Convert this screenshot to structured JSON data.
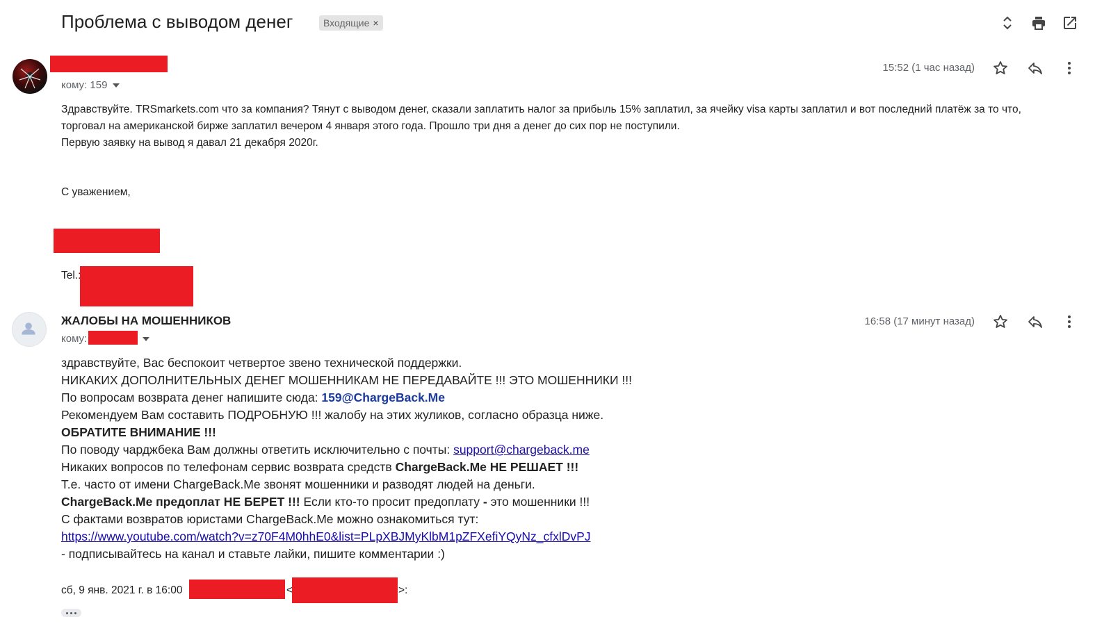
{
  "header": {
    "subject": "Проблема с выводом денег",
    "label": "Входящие",
    "label_close": "×"
  },
  "icons": {
    "expand": "unfold-icon",
    "print": "print-icon",
    "open_new": "open-in-new-window-icon",
    "star": "star-icon",
    "reply": "reply-icon",
    "more": "more-vertical-icon"
  },
  "message1": {
    "time": "15:52 (1 час назад)",
    "to_label": "кому: 159",
    "lines": [
      "Здравствуйте. TRSmarkets.com что за компания? Тянут с выводом денег, сказали заплатить налог за прибыль 15% заплатил, за ячейку visa карты заплатил и вот последний платёж за то что,",
      "торговал на американской бирже заплатил вечером 4 января этого года. Прошло три дня а денег до сих пор не поступили.",
      "Первую заявку на вывод я давал 21 декабря 2020г."
    ],
    "regards": "С уважением,",
    "tel_label": "Tel.:"
  },
  "message2": {
    "sender": "ЖАЛОБЫ НА МОШЕННИКОВ",
    "time": "16:58 (17 минут назад)",
    "to_label": "кому:",
    "l1": "здравствуйте, Вас беспокоит четвертое звено технической поддержки.",
    "l2": "НИКАКИХ ДОПОЛНИТЕЛЬНЫХ ДЕНЕГ МОШЕННИКАМ НЕ ПЕРЕДАВАЙТЕ !!! ЭТО МОШЕННИКИ !!!",
    "l3_text": "По вопросам возврата денег напишите сюда: ",
    "l3_email": "159@ChargeBack.Me",
    "l4": "Рекомендуем Вам составить ПОДРОБНУЮ !!! жалобу на этих жуликов, согласно образца ниже.",
    "l5": "ОБРАТИТЕ ВНИМАНИЕ !!!",
    "l6_text": "По поводу чарджбека Вам должны ответить исключительно с почты: ",
    "l6_email": "support@chargeback.me",
    "l7_text": "Никаких вопросов по телефонам сервис возврата средств ",
    "l7_bold": "ChargeBack.Me НЕ РЕШАЕТ !!!",
    "l8": "Т.е. часто от имени ChargeBack.Me звонят мошенники и разводят людей на деньги.",
    "l9_bold": "ChargeBack.Me предоплат НЕ БЕРЕТ !!!",
    "l9_text": " Если кто-то просит предоплату",
    "l9_dash": " - ",
    "l9_tail": "это мошенники !!!",
    "l10": "С фактами возвратов юристами ChargeBack.Me можно ознакомиться тут:",
    "l11_link": "https://www.youtube.com/watch?v=z70F4M0hhE0&list=PLpXBJMyKlbM1pZFXefiYQyNz_cfxlDvPJ",
    "l12": " - подписывайтесь на канал и ставьте лайки, пишите комментарии :)",
    "quote_date": "сб, 9 янв. 2021 г. в 16:00",
    "quote_lt": "<",
    "quote_gt": ">:"
  },
  "colors": {
    "redaction": "#ec1c24",
    "link": "#1a0dab",
    "email_bold": "#1a3a9e"
  }
}
